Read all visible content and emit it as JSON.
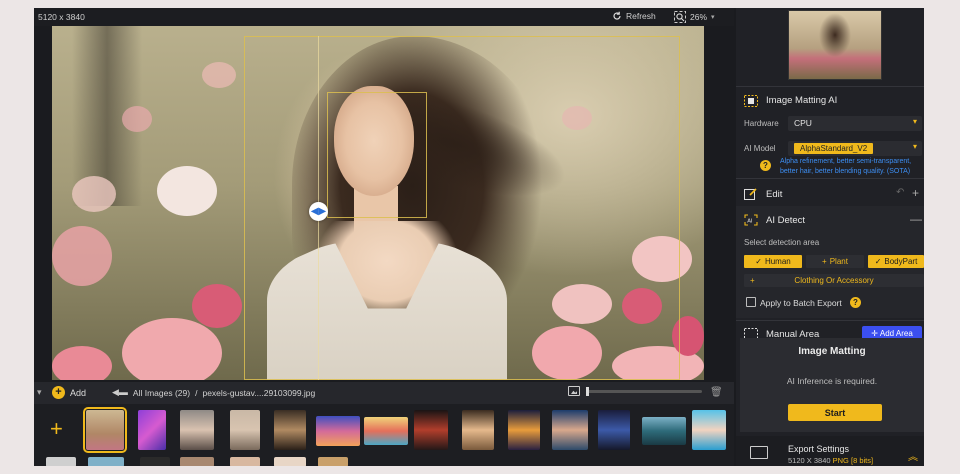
{
  "topbar": {
    "dimensions": "5120 x 3840",
    "refresh_label": "Refresh",
    "zoom_level": "26%"
  },
  "browser": {
    "add_label": "Add",
    "breadcrumb_root": "All Images (29)",
    "breadcrumb_sep": "/",
    "breadcrumb_file": "pexels-gustav....29103099.jpg",
    "thumbnail_size_fraction": 0.0
  },
  "panel": {
    "matting_section": {
      "title": "Image Matting AI",
      "hardware_label": "Hardware",
      "hardware_value": "CPU",
      "model_label": "AI Model",
      "model_value": "AlphaStandard_V2",
      "model_hint": "Alpha refinement, better semi-transparent, better hair, better blending quality. (SOTA)"
    },
    "edit_section": {
      "title": "Edit"
    },
    "detect_section": {
      "title": "AI Detect",
      "subtitle": "Select detection area",
      "tags": [
        {
          "label": "Human",
          "selected": true
        },
        {
          "label": "Plant",
          "selected": false
        },
        {
          "label": "BodyPart",
          "selected": true
        },
        {
          "label": "Clothing Or Accessory",
          "selected": false
        }
      ],
      "batch_label": "Apply to Batch Export",
      "batch_checked": false
    },
    "manual_section": {
      "title": "Manual Area",
      "add_area_label": "Add Area"
    },
    "matting_card": {
      "title": "Image Matting",
      "message": "AI Inference is required.",
      "start_label": "Start"
    },
    "export": {
      "title": "Export Settings",
      "dims": "5120 X 3840",
      "format": "PNG",
      "bits": "[8 bits]"
    }
  },
  "colors": {
    "accent": "#f0b91c",
    "hint_blue": "#3d8ef2",
    "add_area_blue": "#3b4ff0",
    "panel_bg": "#202126"
  }
}
